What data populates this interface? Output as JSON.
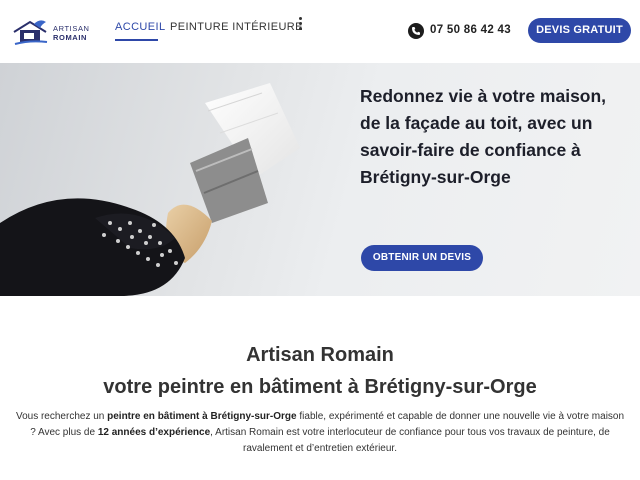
{
  "header": {
    "logo": {
      "line1": "ARTISAN",
      "line2": "ROMAIN",
      "icon": "paint-bucket-house-icon",
      "color": "#2a2f6b"
    },
    "nav": [
      {
        "label": "ACCUEIL",
        "active": true
      },
      {
        "label": "PEINTURE INTÉRIEURE",
        "active": false
      }
    ],
    "more_icon": "vertical-dots-icon",
    "phone": {
      "icon": "phone-icon",
      "number": "07 50 86 42 43"
    },
    "cta_label": "DEVIS GRATUIT"
  },
  "hero": {
    "headline": "Redonnez vie à votre maison, de la façade au toit, avec un savoir-faire de confiance à Brétigny-sur-Orge",
    "button_label": "OBTENIR UN DEVIS",
    "image": "gloved-hand-holding-paintbrush"
  },
  "main": {
    "title_line1": "Artisan Romain",
    "title_line2": "votre peintre en bâtiment à Brétigny-sur-Orge",
    "intro": {
      "p1": "Vous recherchez un ",
      "b1": "peintre en bâtiment à Brétigny-sur-Orge",
      "p2": " fiable, expérimenté et capable de donner une nouvelle vie à votre maison ? Avec plus de ",
      "b2": "12 années d’expérience",
      "p3": ", Artisan Romain est votre interlocuteur de confiance pour tous vos travaux de peinture, de ravalement et d’entretien extérieur."
    }
  },
  "colors": {
    "accent": "#2e48a8",
    "text": "#333333"
  }
}
